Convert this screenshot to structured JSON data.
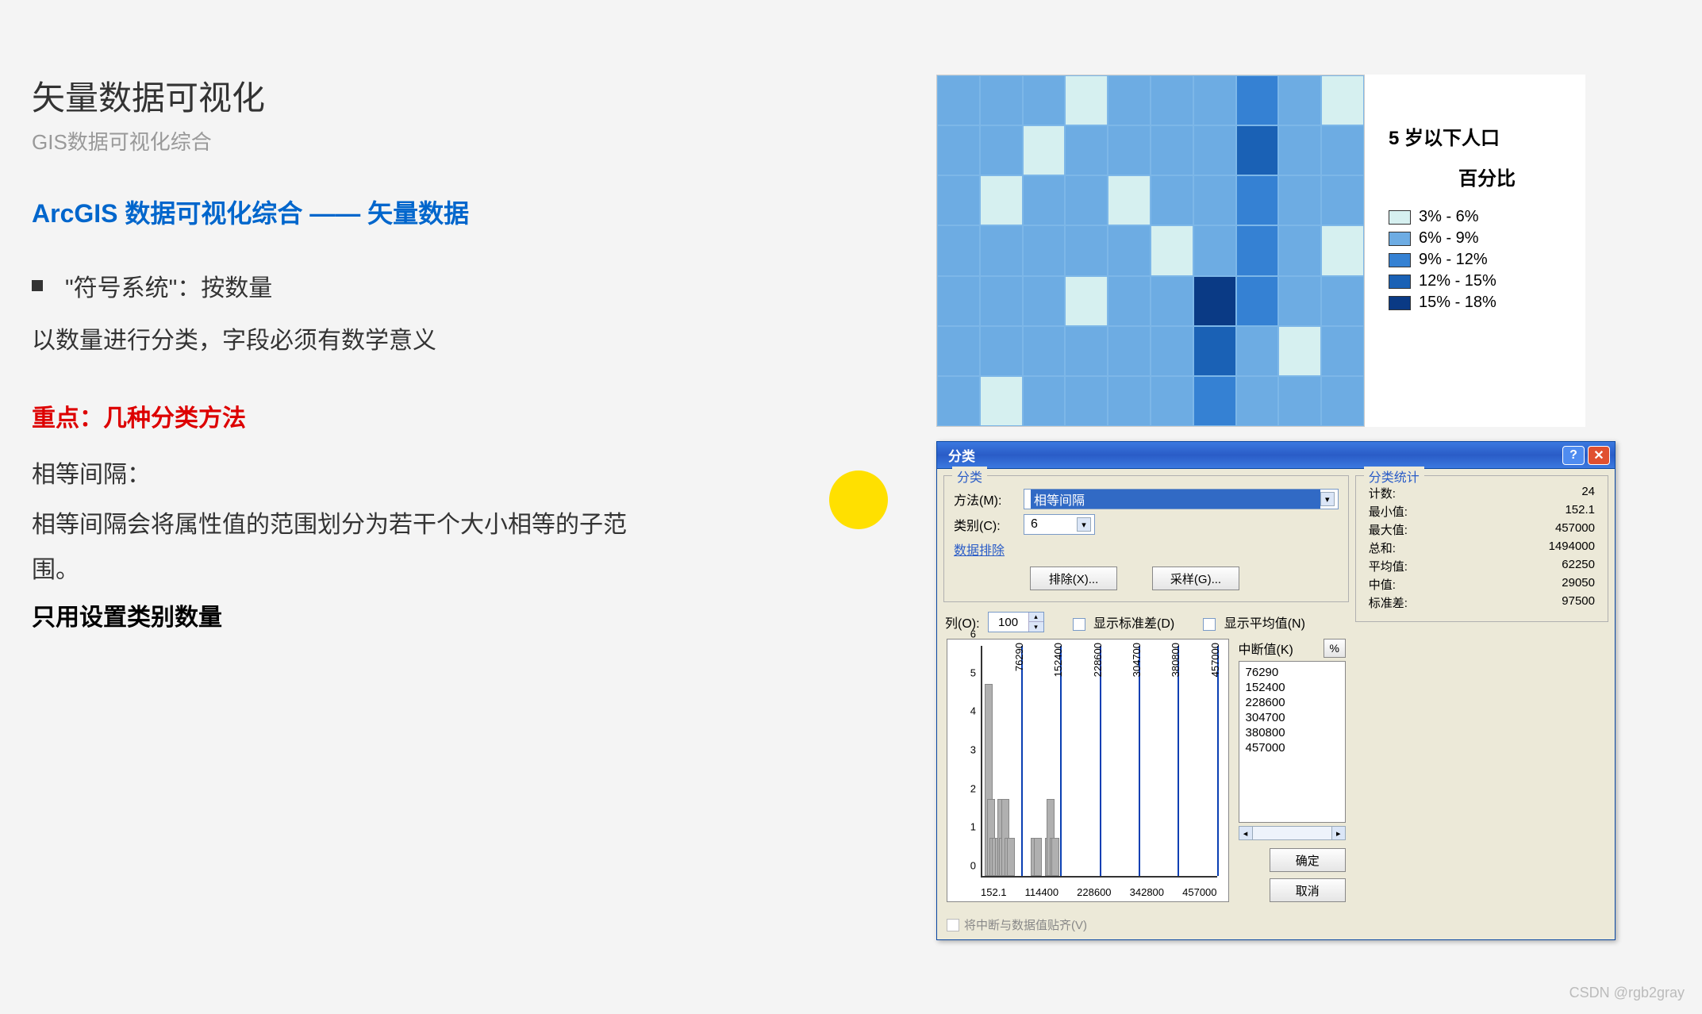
{
  "slide": {
    "title": "矢量数据可视化",
    "subtitle": "GIS数据可视化综合",
    "section_heading": "ArcGIS 数据可视化综合 —— 矢量数据",
    "bullet": "\"符号系统\"：按数量",
    "body": "以数量进行分类，字段必须有数学意义",
    "emph_red": "重点：几种分类方法",
    "para1": "相等间隔：",
    "para2": "相等间隔会将属性值的范围划分为若干个大小相等的子范围。",
    "emph_black": "只用设置类别数量"
  },
  "map_legend": {
    "title1": "5 岁以下人口",
    "title2": "百分比",
    "items": [
      {
        "color": "#d6f0f0",
        "label": "3% - 6%"
      },
      {
        "color": "#6dace3",
        "label": "6% - 9%"
      },
      {
        "color": "#3581d3",
        "label": "9% - 12%"
      },
      {
        "color": "#1a61b5",
        "label": "12% - 15%"
      },
      {
        "color": "#0a3a85",
        "label": "15% - 18%"
      }
    ]
  },
  "dialog": {
    "title": "分类",
    "group_class": "分类",
    "method_label": "方法(M):",
    "method_value": "相等间隔",
    "classes_label": "类别(C):",
    "classes_value": "6",
    "data_exclude": "数据排除",
    "exclude_btn": "排除(X)...",
    "sample_btn": "采样(G)...",
    "group_stats": "分类统计",
    "stats": [
      {
        "k": "计数:",
        "v": "24"
      },
      {
        "k": "最小值:",
        "v": "152.1"
      },
      {
        "k": "最大值:",
        "v": "457000"
      },
      {
        "k": "总和:",
        "v": "1494000"
      },
      {
        "k": "平均值:",
        "v": "62250"
      },
      {
        "k": "中值:",
        "v": "29050"
      },
      {
        "k": "标准差:",
        "v": "97500"
      }
    ],
    "columns_label": "列(O):",
    "columns_value": "100",
    "show_std_label": "显示标准差(D)",
    "show_mean_label": "显示平均值(N)",
    "breaks_label": "中断值(K)",
    "pct_symbol": "%",
    "breaks": [
      "76290",
      "152400",
      "228600",
      "304700",
      "380800",
      "457000"
    ],
    "ok_btn": "确定",
    "cancel_btn": "取消",
    "snap_label": "将中断与数据值贴齐(V)"
  },
  "chart_data": {
    "type": "bar",
    "xlabel": "",
    "ylabel": "",
    "x_ticks": [
      "152.1",
      "114400",
      "228600",
      "342800",
      "457000"
    ],
    "y_ticks": [
      0,
      1,
      2,
      3,
      4,
      5,
      6
    ],
    "ylim": [
      0,
      6
    ],
    "xlim": [
      152.1,
      457000
    ],
    "bars": [
      {
        "x": 5000,
        "y": 5
      },
      {
        "x": 9000,
        "y": 2
      },
      {
        "x": 14000,
        "y": 1
      },
      {
        "x": 18000,
        "y": 1
      },
      {
        "x": 25000,
        "y": 1
      },
      {
        "x": 29000,
        "y": 2
      },
      {
        "x": 33000,
        "y": 1
      },
      {
        "x": 38000,
        "y": 2
      },
      {
        "x": 43000,
        "y": 1
      },
      {
        "x": 48000,
        "y": 1
      },
      {
        "x": 95000,
        "y": 1
      },
      {
        "x": 100000,
        "y": 1
      },
      {
        "x": 122000,
        "y": 1
      },
      {
        "x": 126000,
        "y": 2
      },
      {
        "x": 131000,
        "y": 1
      },
      {
        "x": 135000,
        "y": 1
      }
    ],
    "break_lines": [
      76290,
      152400,
      228600,
      304700,
      380800,
      457000
    ]
  },
  "watermark": "CSDN @rgb2gray"
}
